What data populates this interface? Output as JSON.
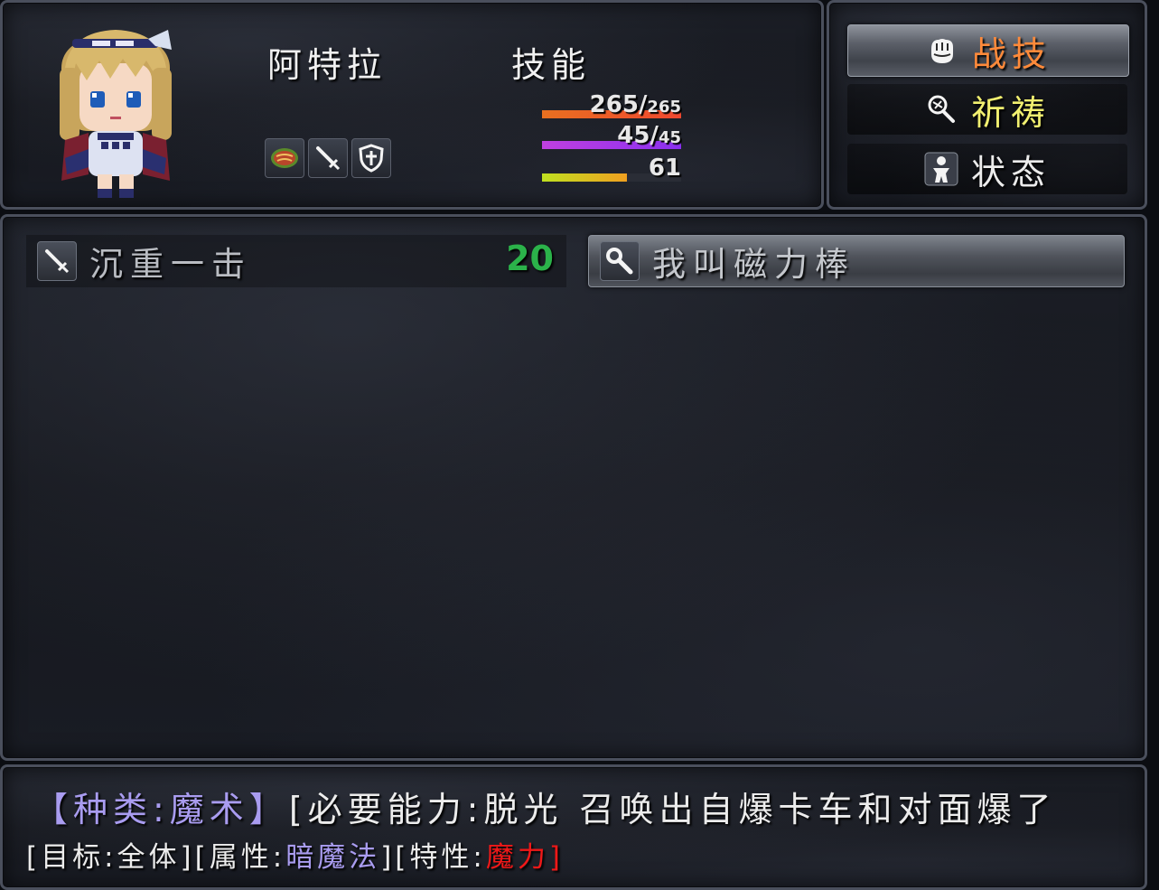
{
  "actor": {
    "name": "阿特拉",
    "portrait": "pixel-girl-portrait",
    "states": [
      "steak-icon",
      "sword-icon",
      "shield-icon"
    ]
  },
  "skill_type_title": "技能",
  "gauges": {
    "hp": {
      "current": "265/",
      "max": "265",
      "ratio": 1.0,
      "colors": [
        "#e87020",
        "#f04830"
      ]
    },
    "mp": {
      "current": "45/",
      "max": "45",
      "ratio": 1.0,
      "colors": [
        "#c040e0",
        "#8a30f0"
      ]
    },
    "tp": {
      "current": "61",
      "ratio": 0.61,
      "colors": [
        "#c0e020",
        "#f0a020"
      ]
    }
  },
  "commands": [
    {
      "label": "战技",
      "icon": "fist-icon",
      "color": "#ff8a3a",
      "selected": true
    },
    {
      "label": "祈祷",
      "icon": "prayer-icon",
      "color": "#f2f070",
      "selected": false
    },
    {
      "label": "状态",
      "icon": "person-icon",
      "color": "#ececec",
      "selected": false
    }
  ],
  "skills": [
    {
      "icon": "sword-icon",
      "name": "沉重一击",
      "cost": "20"
    },
    {
      "icon": "wrench-icon",
      "name": "我叫磁力棒",
      "cost": ""
    }
  ],
  "help": {
    "line1_type": "【种类:魔术】",
    "line1_desc": "[必要能力:脱光 召唤出自爆卡车和对面爆了",
    "line2_target": "[目标:全体]",
    "line2_attr_prefix": "[属性:",
    "line2_attr_value": "暗魔法",
    "line2_attr_suffix": "]",
    "line2_trait_prefix": "[特性:",
    "line2_trait_value": "魔力",
    "line2_trait_suffix": "]"
  }
}
